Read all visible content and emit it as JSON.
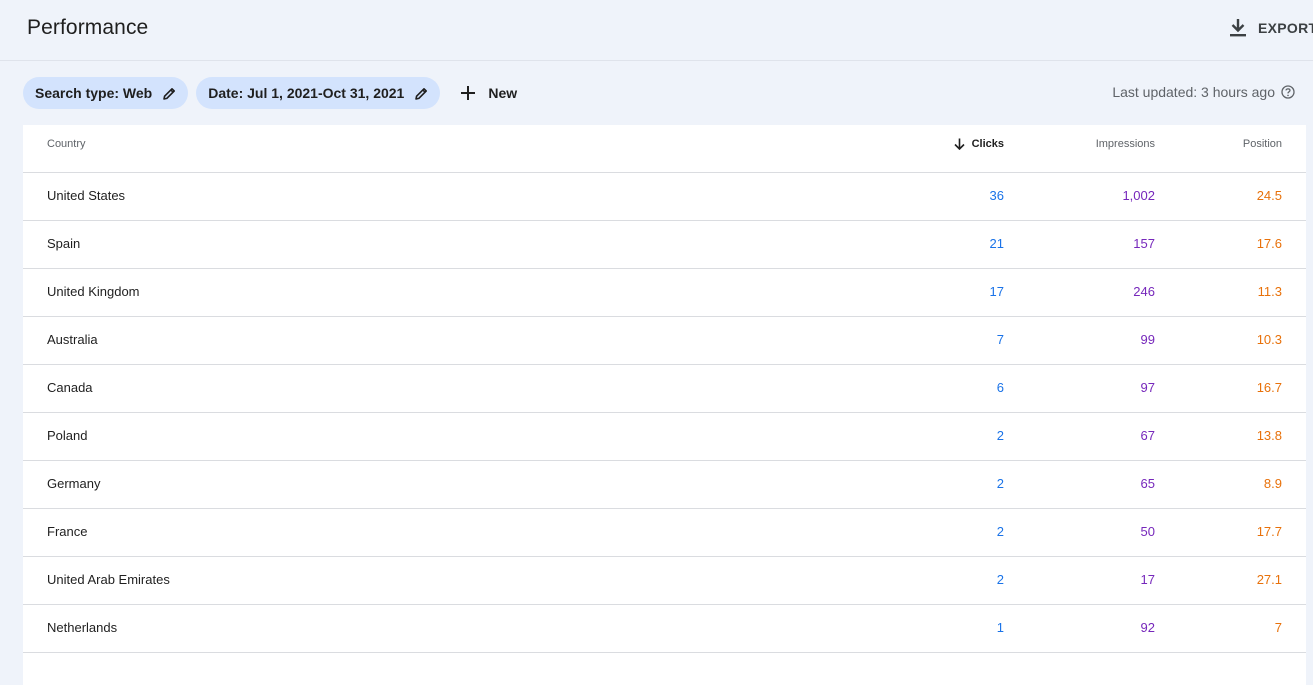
{
  "header": {
    "title": "Performance",
    "export_label": "EXPORT"
  },
  "filters": {
    "chips": [
      {
        "label": "Search type: Web"
      },
      {
        "label": "Date: Jul 1, 2021-Oct 31, 2021"
      }
    ],
    "new_label": "New",
    "last_updated": "Last updated: 3 hours ago"
  },
  "table": {
    "columns": {
      "country": "Country",
      "clicks": "Clicks",
      "impressions": "Impressions",
      "position": "Position"
    },
    "rows": [
      {
        "country": "United States",
        "clicks": "36",
        "impressions": "1,002",
        "position": "24.5"
      },
      {
        "country": "Spain",
        "clicks": "21",
        "impressions": "157",
        "position": "17.6"
      },
      {
        "country": "United Kingdom",
        "clicks": "17",
        "impressions": "246",
        "position": "11.3"
      },
      {
        "country": "Australia",
        "clicks": "7",
        "impressions": "99",
        "position": "10.3"
      },
      {
        "country": "Canada",
        "clicks": "6",
        "impressions": "97",
        "position": "16.7"
      },
      {
        "country": "Poland",
        "clicks": "2",
        "impressions": "67",
        "position": "13.8"
      },
      {
        "country": "Germany",
        "clicks": "2",
        "impressions": "65",
        "position": "8.9"
      },
      {
        "country": "France",
        "clicks": "2",
        "impressions": "50",
        "position": "17.7"
      },
      {
        "country": "United Arab Emirates",
        "clicks": "2",
        "impressions": "17",
        "position": "27.1"
      },
      {
        "country": "Netherlands",
        "clicks": "1",
        "impressions": "92",
        "position": "7"
      }
    ]
  },
  "colors": {
    "clicks": "#1a73e8",
    "impressions": "#7627bb",
    "position": "#e8710a",
    "chip": "#d3e3fd",
    "background": "#eff3fa"
  },
  "icons": {
    "export": "download-icon",
    "edit": "pencil-icon",
    "new": "plus-icon",
    "help": "help-circle-icon",
    "sort": "arrow-down-icon"
  }
}
